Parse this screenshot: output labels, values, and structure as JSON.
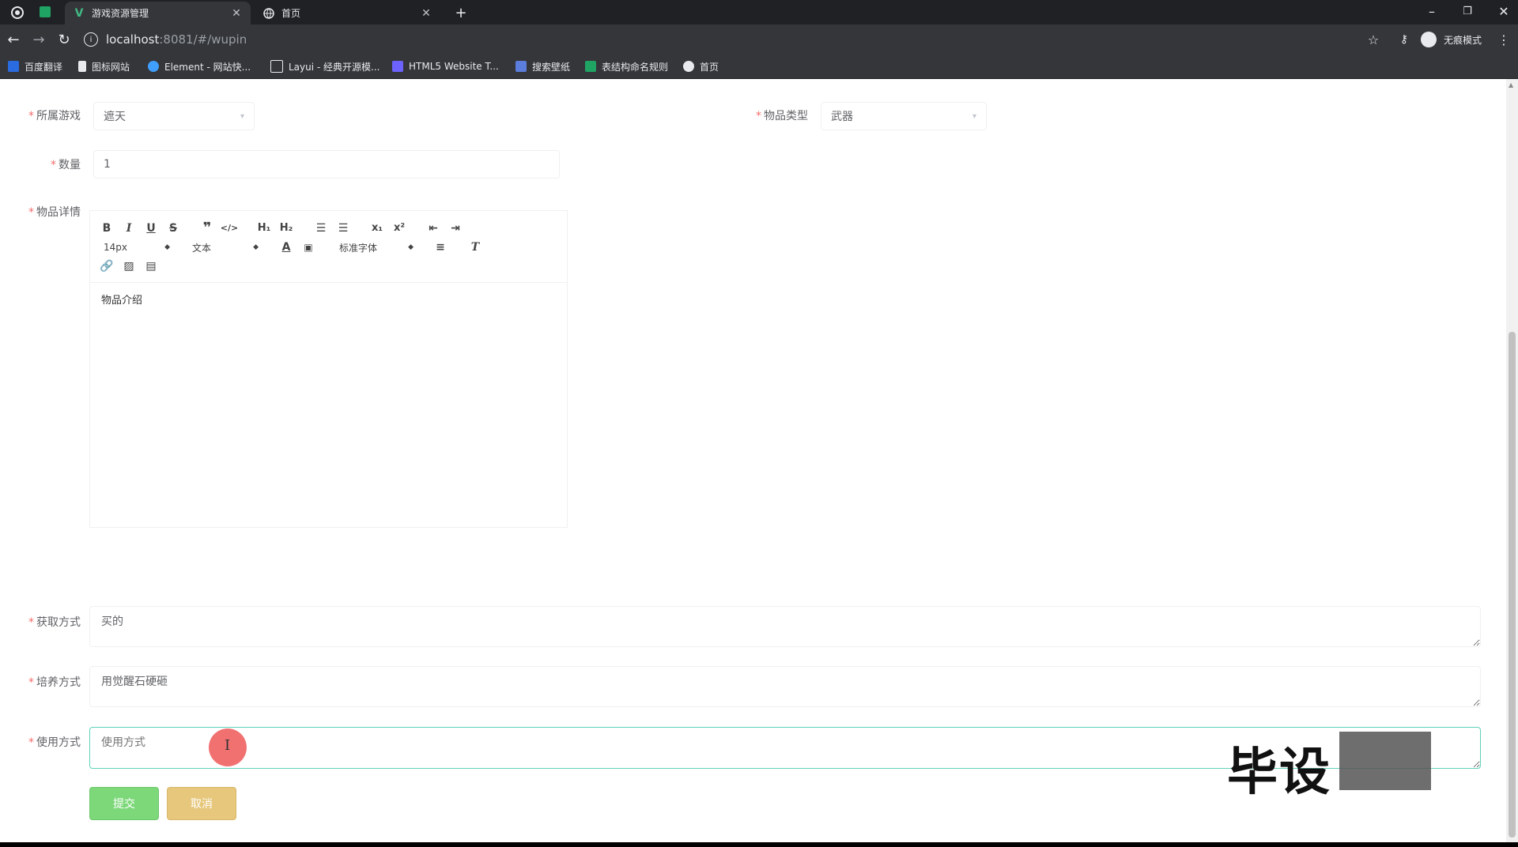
{
  "browser": {
    "tabs": [
      {
        "label": "游戏资源管理",
        "icon": "vue-icon"
      },
      {
        "label": "首页",
        "icon": "globe-icon"
      }
    ],
    "new_tab": "+",
    "url_host": "localhost",
    "url_path": ":8081/#/wupin",
    "profile_label": "无痕模式",
    "bookmarks": [
      "百度翻译",
      "图标网站",
      "Element - 网站快...",
      "Layui - 经典开源模...",
      "HTML5 Website T...",
      "搜索壁纸",
      "表结构命名规则",
      "首页"
    ]
  },
  "form": {
    "game_label": "所属游戏",
    "game_value": "遮天",
    "type_label": "物品类型",
    "type_value": "武器",
    "quantity_label": "数量",
    "quantity_value": "1",
    "detail_label": "物品详情",
    "editor": {
      "font_size": "14px",
      "paragraph": "文本",
      "font_family": "标准字体",
      "content": "物品介绍"
    },
    "obtain_label": "获取方式",
    "obtain_value": "买的",
    "cultivate_label": "培养方式",
    "cultivate_value": "用觉醒石硬砸",
    "usage_label": "使用方式",
    "usage_placeholder": "使用方式",
    "submit_label": "提交",
    "cancel_label": "取消"
  },
  "watermark": "毕设",
  "colors": {
    "submit": "#7dd87a",
    "cancel": "#e6c77b",
    "focus_border": "#5fd1b9",
    "cursor_dot": "#f06262"
  }
}
